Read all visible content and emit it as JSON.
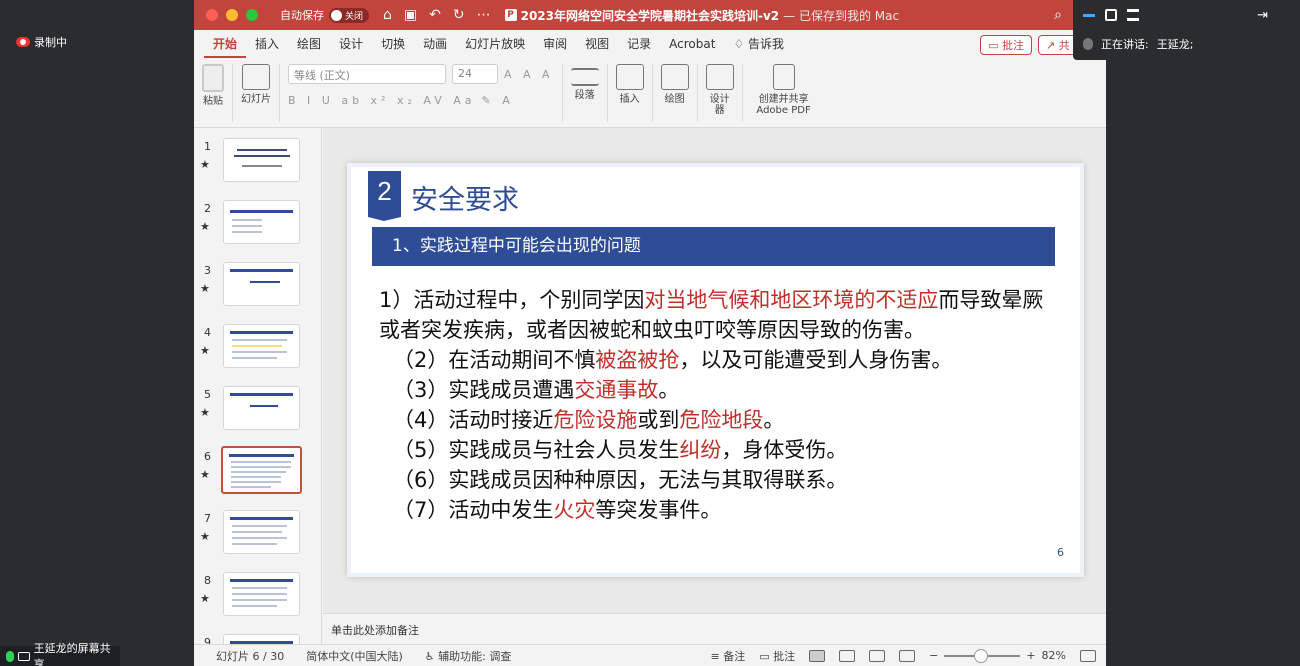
{
  "recording": {
    "label": "录制中"
  },
  "screen_share": {
    "label": "王延龙的屏幕共享"
  },
  "meeting": {
    "speaking_label": "正在讲话:",
    "speaker": "王延龙;"
  },
  "window": {
    "autosave_label": "自动保存",
    "autosave_state": "关闭",
    "title": "2023年网络空间安全学院暑期社会实践培训-v2",
    "saved_status": "— 已保存到我的 Mac"
  },
  "tabs": [
    "开始",
    "插入",
    "绘图",
    "设计",
    "切换",
    "动画",
    "幻灯片放映",
    "审阅",
    "视图",
    "记录",
    "Acrobat",
    "告诉我"
  ],
  "tab_buttons": {
    "comment": "批注",
    "share": "共"
  },
  "ribbon": {
    "paste": "粘贴",
    "slides": "幻灯片",
    "font_name": "等线 (正文)",
    "font_size": "24",
    "paragraph": "段落",
    "insert": "插入",
    "draw": "绘图",
    "designer": "设计器",
    "adobe": "创建并共享 Adobe PDF"
  },
  "thumbnails": [
    {
      "num": "1"
    },
    {
      "num": "2"
    },
    {
      "num": "3"
    },
    {
      "num": "4"
    },
    {
      "num": "5"
    },
    {
      "num": "6"
    },
    {
      "num": "7"
    },
    {
      "num": "8"
    },
    {
      "num": "9"
    }
  ],
  "slide": {
    "section_number": "2",
    "section_title": "安全要求",
    "subtitle": "1、实践过程中可能会出现的问题",
    "item1_a": "1）活动过程中，个别同学因",
    "item1_red": "对当地气候和地区环境的不适应",
    "item1_b": "而导致晕厥或者突发疾病，或者因被蛇和蚊虫叮咬等原因导致的伤害。",
    "item2_a": "（2）在活动期间不慎",
    "item2_red": "被盗被抢",
    "item2_b": "，以及可能遭受到人身伤害。",
    "item3_a": "（3）实践成员遭遇",
    "item3_red": "交通事故",
    "item3_b": "。",
    "item4_a": "（4）活动时接近",
    "item4_red1": "危险设施",
    "item4_mid": "或到",
    "item4_red2": "危险地段",
    "item4_b": "。",
    "item5_a": "（5）实践成员与社会人员发生",
    "item5_red": "纠纷",
    "item5_b": "，身体受伤。",
    "item6": "（6）实践成员因种种原因，无法与其取得联系。",
    "item7_a": "（7）活动中发生",
    "item7_red": "火灾",
    "item7_b": "等突发事件。",
    "page_number": "6"
  },
  "notes_placeholder": "单击此处添加备注",
  "status": {
    "slide_info": "幻灯片 6 / 30",
    "language": "简体中文(中国大陆)",
    "accessibility": "辅助功能: 调查",
    "notes": "备注",
    "comments": "批注",
    "zoom": "82%"
  }
}
